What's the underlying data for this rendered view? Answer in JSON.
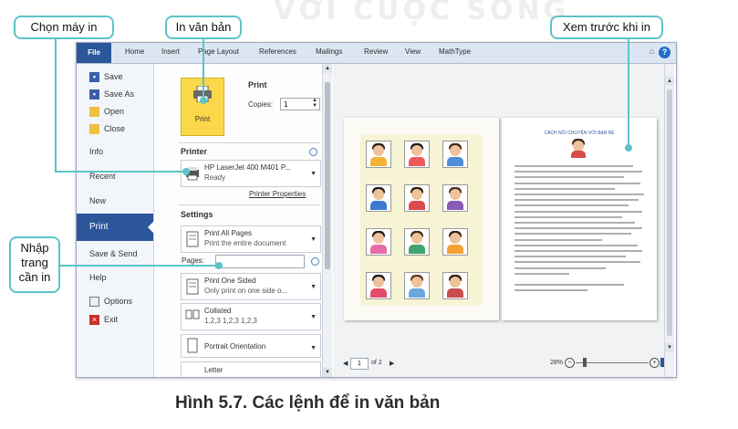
{
  "watermark": "VỚI CUỘC SỐNG",
  "ribbon": {
    "tabs": [
      "File",
      "Home",
      "Insert",
      "Page Layout",
      "References",
      "Mailings",
      "Review",
      "View",
      "MathType"
    ],
    "help": "?"
  },
  "nav": {
    "items": [
      {
        "label": "Save",
        "icon": "save-icon"
      },
      {
        "label": "Save As",
        "icon": "save-as-icon"
      },
      {
        "label": "Open",
        "icon": "open-folder-icon"
      },
      {
        "label": "Close",
        "icon": "close-folder-icon"
      },
      {
        "label": "Info"
      },
      {
        "label": "Recent"
      },
      {
        "label": "New"
      },
      {
        "label": "Print"
      },
      {
        "label": "Save & Send"
      },
      {
        "label": "Help"
      },
      {
        "label": "Options",
        "icon": "options-icon"
      },
      {
        "label": "Exit",
        "icon": "exit-icon"
      }
    ]
  },
  "print": {
    "heading": "Print",
    "button_label": "Print",
    "copies_label": "Copies:",
    "copies_value": "1",
    "printer_heading": "Printer",
    "printer_name": "HP LaserJet 400 M401 P...",
    "printer_status": "Ready",
    "printer_properties": "Printer Properties",
    "settings_heading": "Settings",
    "pages_label": "Pages:",
    "settings": [
      {
        "l1": "Print All Pages",
        "l2": "Print the entire document"
      },
      {
        "l1": "Print One Sided",
        "l2": "Only print on one side o..."
      },
      {
        "l1": "Collated",
        "l2": "1,2,3   1,2,3   1,2,3"
      },
      {
        "l1": "Portrait Orientation",
        "l2": ""
      },
      {
        "l1": "Letter",
        "l2": ""
      }
    ]
  },
  "preview": {
    "page_current": "1",
    "page_total": "of 2",
    "zoom": "28%",
    "right_page_title": "CÁCH NÓI CHUYỆN VỚI BẠN BÈ"
  },
  "callouts": {
    "chon_may_in": "Chọn máy in",
    "in_van_ban": "In văn bản",
    "xem_truoc": "Xem trước khi in",
    "nhap_trang": "Nhập\ntrang\ncần in"
  },
  "caption": "Hình 5.7. Các lệnh để in văn bản",
  "colors": {
    "accent": "#2b579a",
    "callout": "#5cc4c9",
    "print_button": "#fbd84a"
  }
}
